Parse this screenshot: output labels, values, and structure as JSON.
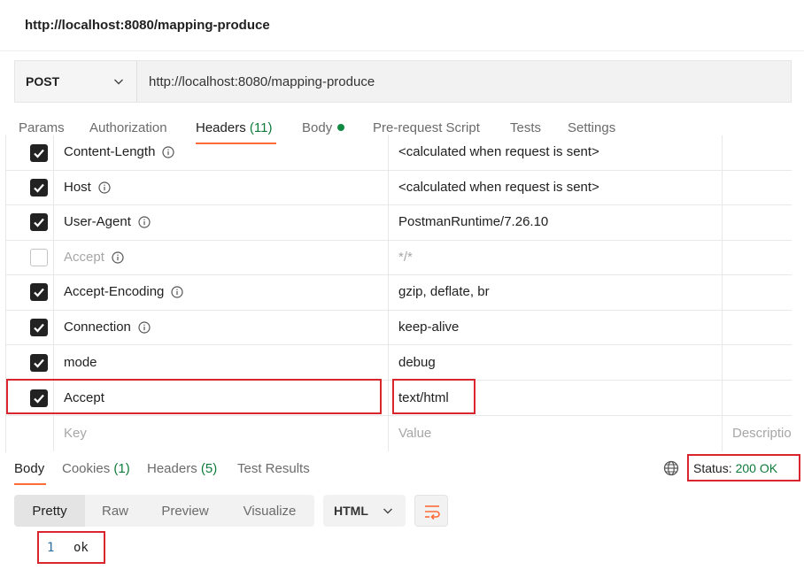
{
  "request_title": "http://localhost:8080/mapping-produce",
  "url_bar": {
    "method": "POST",
    "url": "http://localhost:8080/mapping-produce"
  },
  "request_tabs": {
    "params": "Params",
    "authorization": "Authorization",
    "headers": "Headers",
    "headers_count": "(11)",
    "body": "Body",
    "pre_request": "Pre-request Script",
    "tests": "Tests",
    "settings": "Settings"
  },
  "headers": [
    {
      "key": "Content-Length",
      "value": "<calculated when request is sent>",
      "checked": true
    },
    {
      "key": "Host",
      "value": "<calculated when request is sent>",
      "checked": true
    },
    {
      "key": "User-Agent",
      "value": "PostmanRuntime/7.26.10",
      "checked": true
    },
    {
      "key": "Accept",
      "value": "*/*",
      "checked": false
    },
    {
      "key": "Accept-Encoding",
      "value": "gzip, deflate, br",
      "checked": true
    },
    {
      "key": "Connection",
      "value": "keep-alive",
      "checked": true
    },
    {
      "key": "mode",
      "value": "debug",
      "checked": true
    },
    {
      "key": "Accept",
      "value": "text/html",
      "checked": true
    }
  ],
  "header_placeholder": {
    "key": "Key",
    "value": "Value",
    "description": "Description"
  },
  "response_tabs": {
    "body": "Body",
    "cookies": "Cookies",
    "cookies_count": "(1)",
    "headers": "Headers",
    "headers_count": "(5)",
    "test_results": "Test Results"
  },
  "status": {
    "label": "Status:",
    "code": "200 OK"
  },
  "format_buttons": {
    "pretty": "Pretty",
    "raw": "Raw",
    "preview": "Preview",
    "visualize": "Visualize"
  },
  "language": "HTML",
  "response_body": {
    "line_number": "1",
    "text": "ok"
  },
  "colors": {
    "accent": "#ff6c37",
    "success": "#0f7b3a",
    "highlight": "#d9262e"
  }
}
